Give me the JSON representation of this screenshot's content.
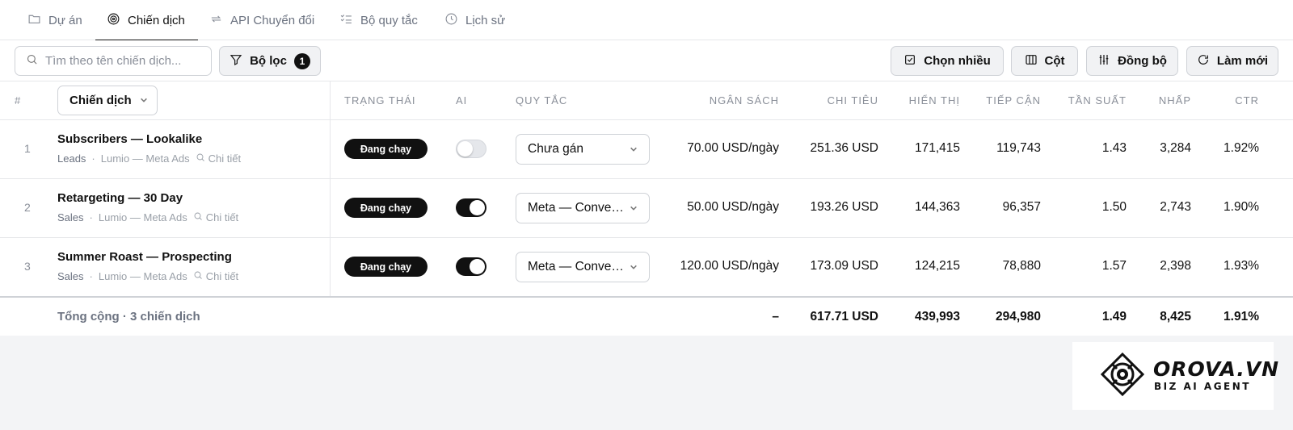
{
  "tabs": [
    {
      "label": "Dự án",
      "icon": "folder-icon"
    },
    {
      "label": "Chiến dịch",
      "icon": "target-icon",
      "active": true
    },
    {
      "label": "API Chuyển đổi",
      "icon": "repeat-icon"
    },
    {
      "label": "Bộ quy tắc",
      "icon": "checklist-icon"
    },
    {
      "label": "Lịch sử",
      "icon": "clock-icon"
    }
  ],
  "toolbar": {
    "search_placeholder": "Tìm theo tên chiến dịch...",
    "filter_label": "Bộ lọc",
    "filter_count": "1",
    "multi_select_label": "Chọn nhiều",
    "columns_label": "Cột",
    "sync_label": "Đồng bộ",
    "refresh_label": "Làm mới"
  },
  "table": {
    "headers": {
      "index": "#",
      "campaign": "Chiến dịch",
      "status": "Trạng thái",
      "ai": "AI",
      "rule": "Quy tắc",
      "budget": "Ngân sách",
      "spend": "Chi tiêu",
      "impressions": "Hiển thị",
      "reach": "Tiếp cận",
      "frequency": "Tần suất",
      "clicks": "Nhấp",
      "ctr": "CTR"
    },
    "rows": [
      {
        "index": "1",
        "name": "Subscribers — Lookalike",
        "objective": "Leads",
        "account": "Lumio — Meta Ads",
        "detail": "Chi tiết",
        "status": "Đang chạy",
        "ai_on": false,
        "rule": "Chưa gán",
        "budget": "70.00 USD/ngày",
        "spend": "251.36 USD",
        "impressions": "171,415",
        "reach": "119,743",
        "frequency": "1.43",
        "clicks": "3,284",
        "ctr": "1.92%"
      },
      {
        "index": "2",
        "name": "Retargeting — 30 Day",
        "objective": "Sales",
        "account": "Lumio — Meta Ads",
        "detail": "Chi tiết",
        "status": "Đang chạy",
        "ai_on": true,
        "rule": "Meta — Conversion",
        "budget": "50.00 USD/ngày",
        "spend": "193.26 USD",
        "impressions": "144,363",
        "reach": "96,357",
        "frequency": "1.50",
        "clicks": "2,743",
        "ctr": "1.90%"
      },
      {
        "index": "3",
        "name": "Summer Roast — Prospecting",
        "objective": "Sales",
        "account": "Lumio — Meta Ads",
        "detail": "Chi tiết",
        "status": "Đang chạy",
        "ai_on": true,
        "rule": "Meta — Conversion",
        "budget": "120.00 USD/ngày",
        "spend": "173.09 USD",
        "impressions": "124,215",
        "reach": "78,880",
        "frequency": "1.57",
        "clicks": "2,398",
        "ctr": "1.93%"
      }
    ],
    "totals": {
      "label": "Tổng cộng · 3 chiến dịch",
      "budget": "–",
      "spend": "617.71 USD",
      "impressions": "439,993",
      "reach": "294,980",
      "frequency": "1.49",
      "clicks": "8,425",
      "ctr": "1.91%"
    }
  },
  "logo": {
    "brand": "OROVA.VN",
    "tagline": "BIZ AI AGENT"
  },
  "colors": {
    "accent": "#111111",
    "background": "#f3f4f6",
    "border": "#cfd2d7",
    "muted_text": "#8a8f99"
  }
}
